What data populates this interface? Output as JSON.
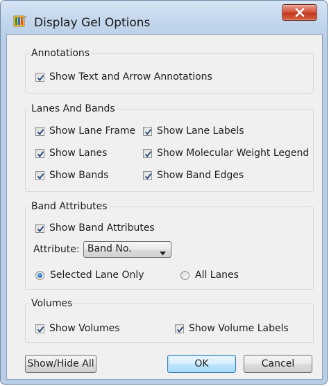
{
  "window": {
    "title": "Display Gel Options"
  },
  "annotations": {
    "title": "Annotations",
    "show_text_arrow": {
      "label": "Show Text and Arrow Annotations",
      "checked": true
    }
  },
  "lanes_and_bands": {
    "title": "Lanes And Bands",
    "show_lane_frame": {
      "label": "Show Lane Frame",
      "checked": true
    },
    "show_lane_labels": {
      "label": "Show Lane Labels",
      "checked": true
    },
    "show_lanes": {
      "label": "Show Lanes",
      "checked": true
    },
    "show_mw_legend": {
      "label": "Show Molecular Weight Legend",
      "checked": true
    },
    "show_bands": {
      "label": "Show Bands",
      "checked": true
    },
    "show_band_edges": {
      "label": "Show Band Edges",
      "checked": true
    }
  },
  "band_attributes": {
    "title": "Band Attributes",
    "show_band_attributes": {
      "label": "Show Band Attributes",
      "checked": true
    },
    "attribute_label": "Attribute:",
    "attribute_value": "Band No.",
    "selected_lane_only": {
      "label": "Selected Lane Only",
      "selected": true
    },
    "all_lanes": {
      "label": "All Lanes",
      "selected": false
    }
  },
  "volumes": {
    "title": "Volumes",
    "show_volumes": {
      "label": "Show Volumes",
      "checked": true
    },
    "show_volume_labels": {
      "label": "Show Volume Labels",
      "checked": true
    }
  },
  "buttons": {
    "show_hide_all": "Show/Hide All",
    "ok": "OK",
    "cancel": "Cancel"
  },
  "colors": {
    "window_frame": "#b9cfe8",
    "client_background": "#f0f0f0",
    "close_button": "#c23b22",
    "check_mark": "#2b4a7a",
    "radio_dot": "#1d5fa8"
  }
}
